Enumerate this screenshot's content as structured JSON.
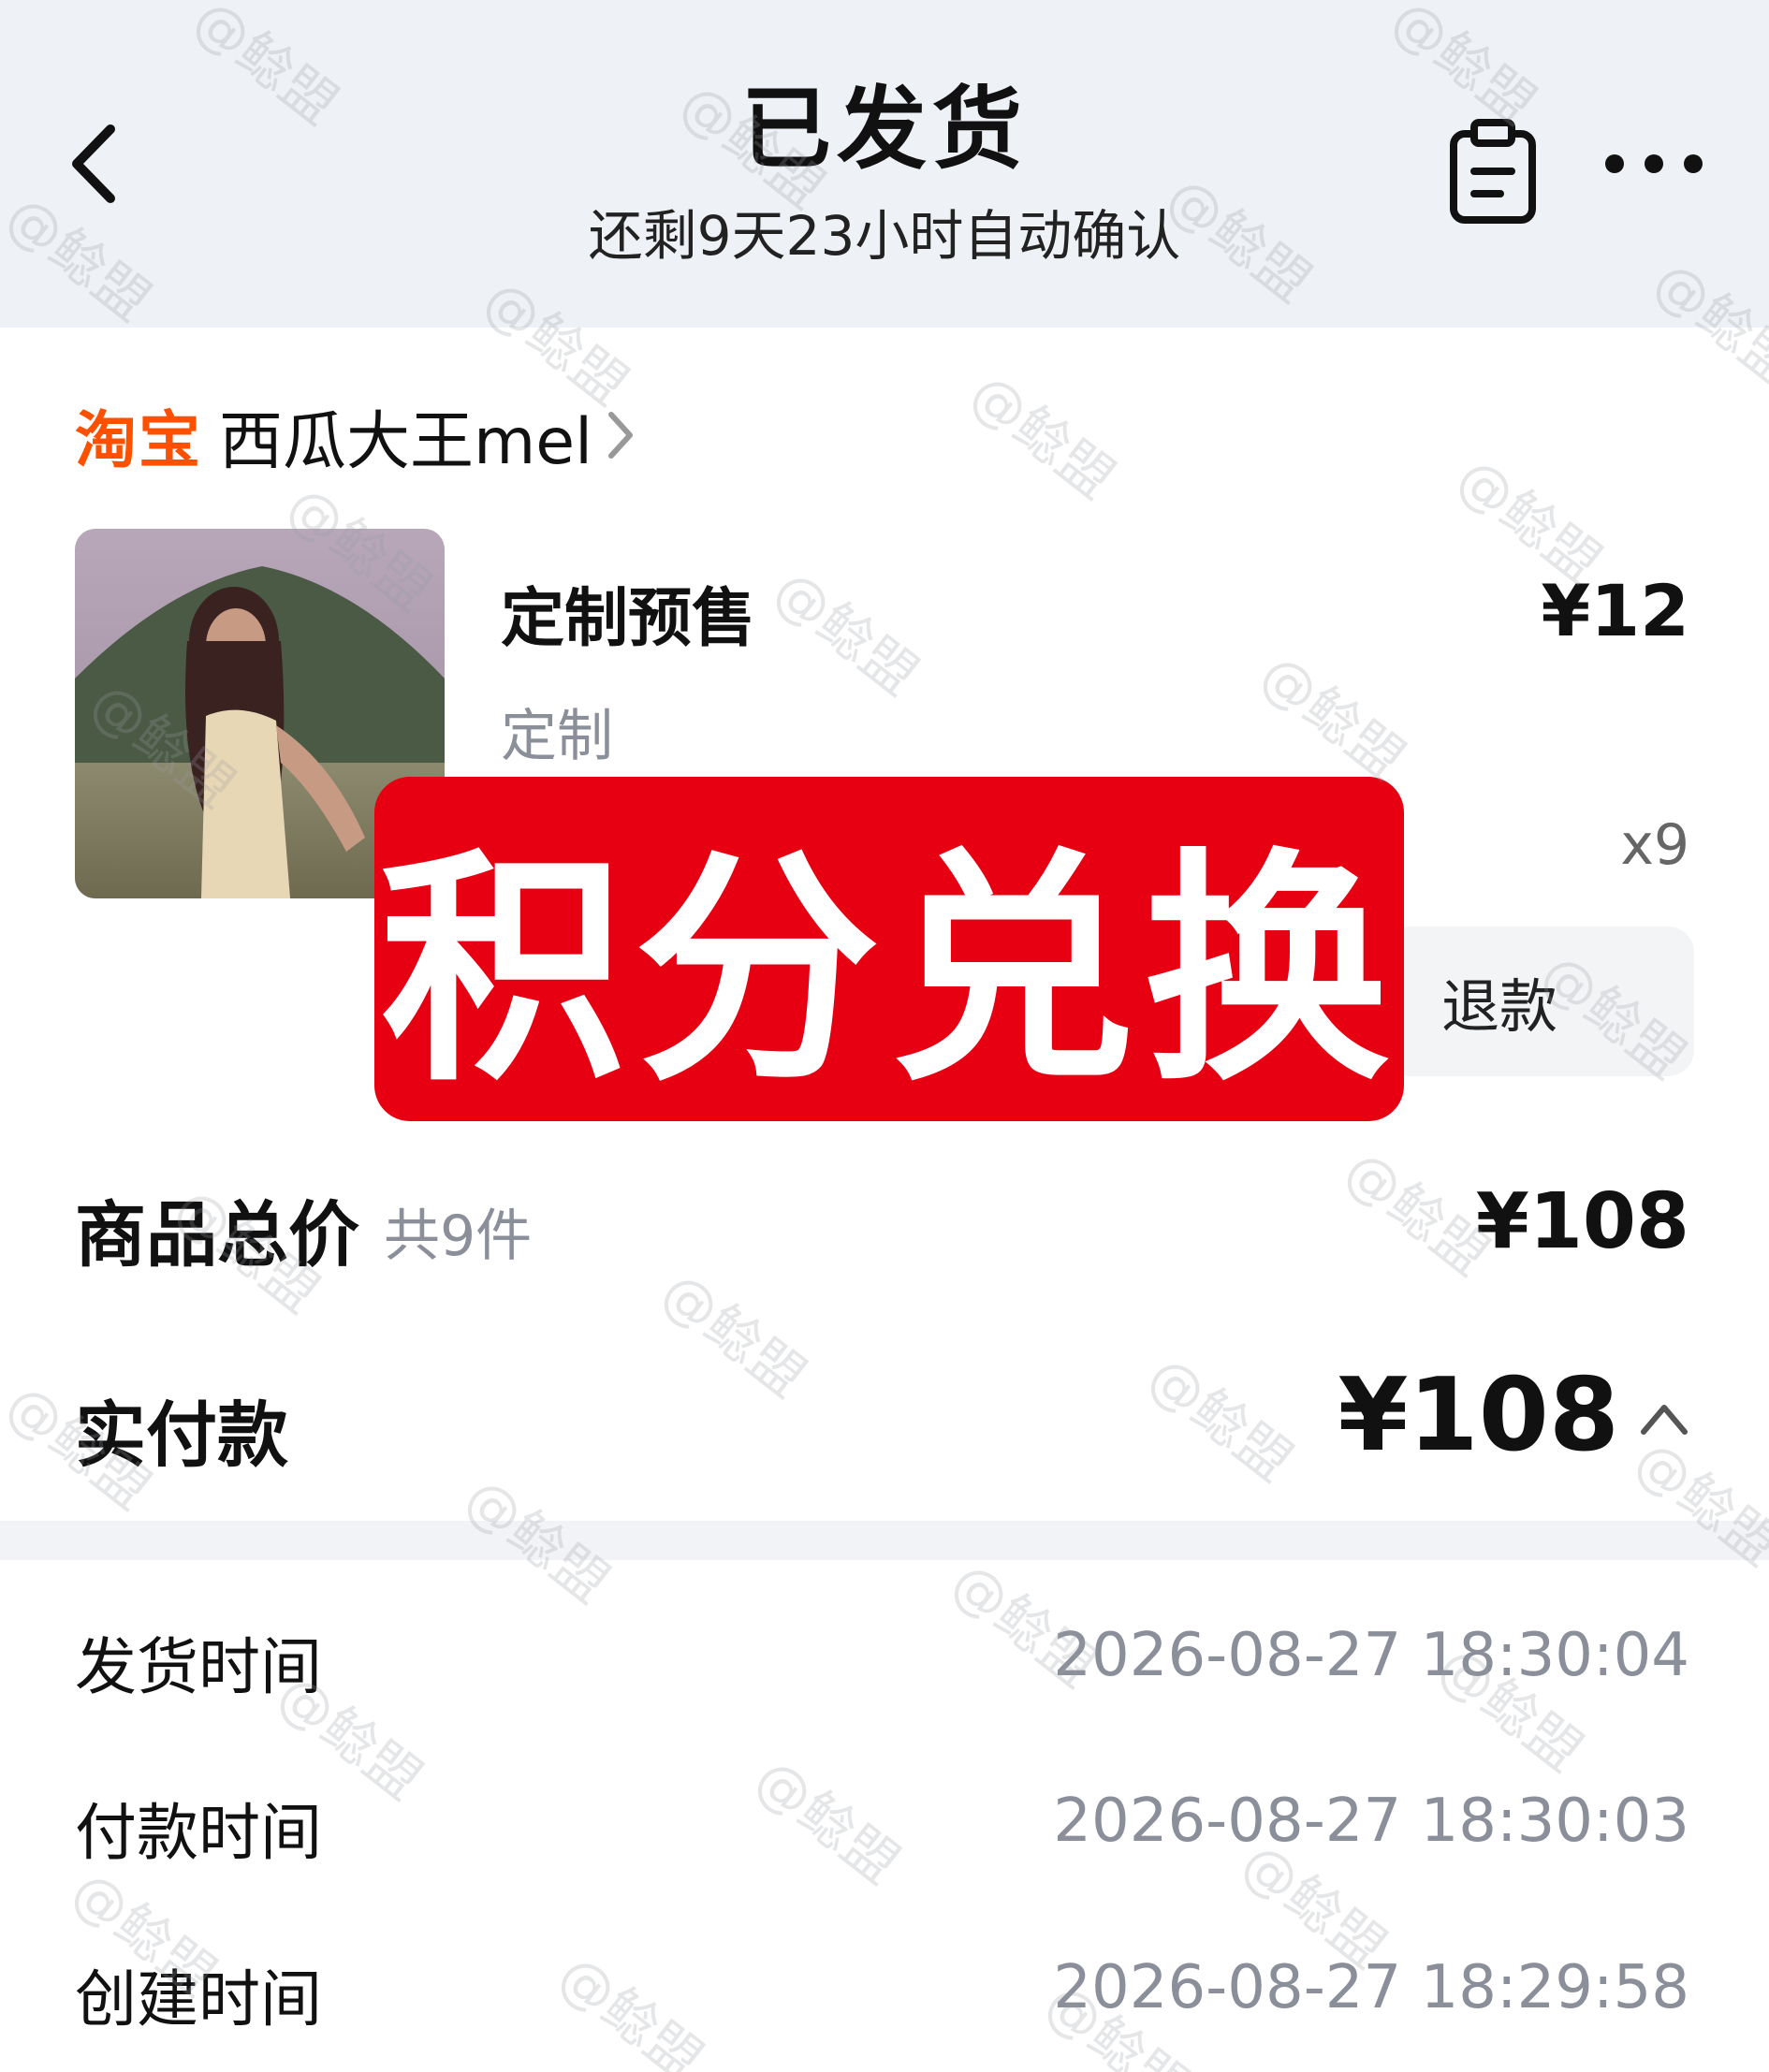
{
  "header": {
    "title": "已发货",
    "subtitle": "还剩9天23小时自动确认"
  },
  "shop": {
    "platform": "淘宝",
    "name": "西瓜大王mel"
  },
  "product": {
    "title": "定制预售",
    "spec": "定制",
    "price": "¥12",
    "quantity": "x9",
    "refund_label": "退款"
  },
  "overlay_text": "积分兑换",
  "summary": {
    "total_label": "商品总价",
    "total_count": "共9件",
    "total_price": "¥108",
    "paid_label": "实付款",
    "paid_price": "¥108"
  },
  "times": [
    {
      "label": "发货时间",
      "value": "2026-08-27 18:30:04"
    },
    {
      "label": "付款时间",
      "value": "2026-08-27 18:30:03"
    },
    {
      "label": "创建时间",
      "value": "2026-08-27 18:29:58"
    }
  ],
  "watermark": "@鲶盟",
  "colors": {
    "taobao": "#ff5000",
    "overlay": "#e60012",
    "header_bg": "#eef1f5",
    "muted_text": "#8a8f99"
  }
}
